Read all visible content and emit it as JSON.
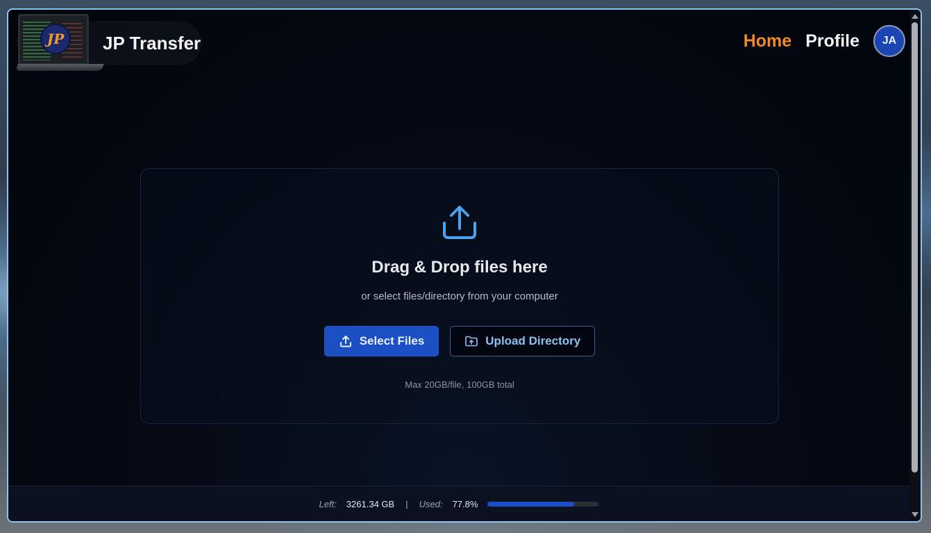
{
  "header": {
    "brand_name": "JP Transfer",
    "logo_text": "JP",
    "nav": [
      {
        "label": "Home",
        "active": true
      },
      {
        "label": "Profile",
        "active": false
      }
    ],
    "avatar_initials": "JA"
  },
  "dropzone": {
    "icon": "upload-icon",
    "title": "Drag & Drop files here",
    "subtitle": "or select files/directory from your computer",
    "select_files_label": "Select Files",
    "upload_directory_label": "Upload Directory",
    "note": "Max 20GB/file, 100GB total"
  },
  "footer": {
    "left_label": "Left:",
    "left_value": "3261.34 GB",
    "separator": "|",
    "used_label": "Used:",
    "used_value": "77.8%",
    "used_fraction": 0.778
  },
  "colors": {
    "accent": "#1c4fc4",
    "active_nav": "#f28a24",
    "icon_blue": "#4aa3f0"
  }
}
